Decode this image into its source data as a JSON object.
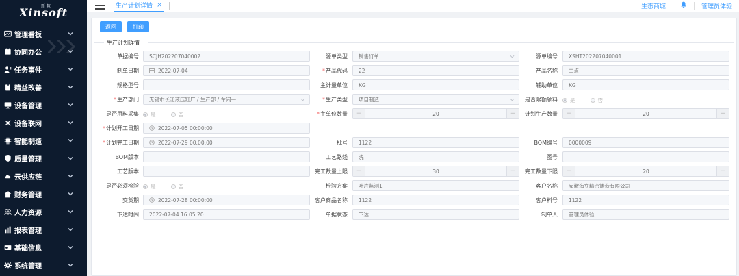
{
  "sidebar": {
    "brand": "Xinsoft",
    "brand_cn": "新软",
    "items": [
      {
        "label": "管理看板",
        "icon": "chart-line-icon"
      },
      {
        "label": "协同办公",
        "icon": "calendar-icon"
      },
      {
        "label": "任务事件",
        "icon": "person-task-icon"
      },
      {
        "label": "精益改善",
        "icon": "clipboard-icon"
      },
      {
        "label": "设备管理",
        "icon": "monitor-icon"
      },
      {
        "label": "设备联网",
        "icon": "network-icon"
      },
      {
        "label": "智能制造",
        "icon": "chip-icon"
      },
      {
        "label": "质量管理",
        "icon": "shield-icon"
      },
      {
        "label": "云供应链",
        "icon": "cloud-link-icon"
      },
      {
        "label": "财务管理",
        "icon": "finance-icon"
      },
      {
        "label": "人力资源",
        "icon": "people-icon"
      },
      {
        "label": "报表管理",
        "icon": "bar-chart-icon"
      },
      {
        "label": "基础信息",
        "icon": "id-card-icon"
      },
      {
        "label": "系统管理",
        "icon": "gear-icon"
      }
    ]
  },
  "topbar": {
    "tab_label": "生产计划详情",
    "tab_close": "×",
    "eco_mall": "生态商城",
    "user": "管理员体验"
  },
  "actions": {
    "back": "返回",
    "print": "打印"
  },
  "section_title": "生产计划详情",
  "fields": {
    "doc_no": {
      "label": "单据编号",
      "value": "SCJH202207040002"
    },
    "source_type": {
      "label": "源单类型",
      "value": "销售订单"
    },
    "source_no": {
      "label": "源单编号",
      "value": "XSHT202207040001"
    },
    "doc_date": {
      "label": "制单日期",
      "value": "2022-07-04"
    },
    "product_code": {
      "label": "产品代码",
      "value": "22"
    },
    "product_name": {
      "label": "产品名称",
      "value": "二点"
    },
    "spec": {
      "label": "规格型号",
      "value": ""
    },
    "main_unit": {
      "label": "主计量单位",
      "value": "KG"
    },
    "aux_unit": {
      "label": "辅助单位",
      "value": "KG"
    },
    "dept": {
      "label": "生产部门",
      "value": "无锡市长江液压缸厂 / 生产部 / 车间一"
    },
    "prod_type": {
      "label": "生产类型",
      "value": "项目制造"
    },
    "limit_pick": {
      "label": "是否限额领料",
      "yes": "是",
      "no": "否"
    },
    "use_material": {
      "label": "是否用料采集",
      "yes": "是",
      "no": "否"
    },
    "main_qty": {
      "label": "主单位数量",
      "value": "20"
    },
    "plan_qty": {
      "label": "计划生产数量",
      "value": "20"
    },
    "plan_start": {
      "label": "计划开工日期",
      "value": "2022-07-05 00:00:00"
    },
    "plan_end": {
      "label": "计划完工日期",
      "value": "2022-07-29 00:00:00"
    },
    "batch_no": {
      "label": "批号",
      "value": "1122"
    },
    "bom_no": {
      "label": "BOM编号",
      "value": "0000009"
    },
    "bom_ver": {
      "label": "BOM版本",
      "value": ""
    },
    "route": {
      "label": "工艺路线",
      "value": "洗"
    },
    "drawing": {
      "label": "图号",
      "value": ""
    },
    "route_ver": {
      "label": "工艺版本",
      "value": ""
    },
    "upper": {
      "label": "完工数量上限",
      "value": "30"
    },
    "lower": {
      "label": "完工数量下限",
      "value": "20"
    },
    "must_inspect": {
      "label": "是否必须检验",
      "yes": "是",
      "no": "否"
    },
    "inspect_plan": {
      "label": "检验方案",
      "value": "叶片监测1"
    },
    "customer": {
      "label": "客户名称",
      "value": "安徽海立精密铸造有限公司"
    },
    "delivery": {
      "label": "交货期",
      "value": "2022-07-28 00:00:00"
    },
    "cust_product": {
      "label": "客户商品名称",
      "value": "1122"
    },
    "cust_part": {
      "label": "客户料号",
      "value": "1122"
    },
    "issue_time": {
      "label": "下达时间",
      "value": "2022-07-04 16:05:20"
    },
    "status": {
      "label": "单据状态",
      "value": "下达"
    },
    "maker": {
      "label": "制单人",
      "value": "管理员体验"
    }
  }
}
